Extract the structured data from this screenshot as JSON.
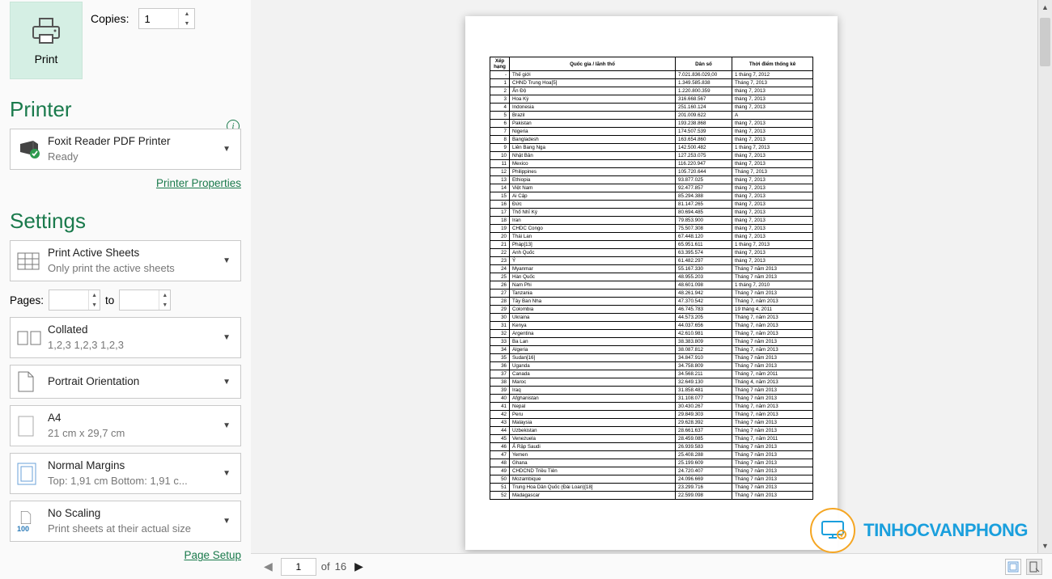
{
  "print": {
    "label": "Print"
  },
  "copies": {
    "label": "Copies:",
    "value": "1"
  },
  "printer_section": {
    "title": "Printer"
  },
  "printer": {
    "name": "Foxit Reader PDF Printer",
    "status": "Ready",
    "properties_link": "Printer Properties"
  },
  "settings_section": {
    "title": "Settings"
  },
  "print_what": {
    "label": "Print Active Sheets",
    "sub": "Only print the active sheets"
  },
  "pages": {
    "label": "Pages:",
    "to": "to",
    "from": "",
    "to_val": ""
  },
  "collate": {
    "label": "Collated",
    "sub": "1,2,3    1,2,3    1,2,3"
  },
  "orientation": {
    "label": "Portrait Orientation"
  },
  "paper": {
    "label": "A4",
    "sub": "21 cm x 29,7 cm"
  },
  "margins": {
    "label": "Normal Margins",
    "sub": "Top: 1,91 cm Bottom: 1,91 c..."
  },
  "scaling": {
    "label": "No Scaling",
    "sub": "Print sheets at their actual size"
  },
  "page_setup_link": "Page Setup",
  "nav": {
    "current_page": "1",
    "page_count": "16",
    "of": "of"
  },
  "watermark": {
    "text": "TINHOCVANPHONG"
  },
  "doc": {
    "headers": [
      "Xếp hạng",
      "Quốc gia / lãnh thổ",
      "Dân số",
      "Thời điểm thống kê"
    ],
    "rows": [
      [
        "-",
        "Thế giới",
        "7.021.836.029,00",
        "1 tháng 7, 2012"
      ],
      [
        "1",
        "CHND Trung Hoa[5]",
        "1.349.585.838",
        "Tháng 7, 2013"
      ],
      [
        "2",
        "Ấn Độ",
        "1.220.800.359",
        "tháng 7, 2013"
      ],
      [
        "3",
        "Hoa Kỳ",
        "316.668.567",
        "tháng 7, 2013"
      ],
      [
        "4",
        "Indonesia",
        "251.160.124",
        "tháng 7, 2013"
      ],
      [
        "5",
        "Brazil",
        "201.009.622",
        "A"
      ],
      [
        "6",
        "Pakistan",
        "193.238.868",
        "tháng 7, 2013"
      ],
      [
        "7",
        "Nigeria",
        "174.507.539",
        "tháng 7, 2013"
      ],
      [
        "8",
        "Bangladesh",
        "163.654.860",
        "tháng 7, 2013"
      ],
      [
        "9",
        "Liên Bang Nga",
        "142.500.482",
        "1 tháng 7, 2013"
      ],
      [
        "10",
        "Nhật Bản",
        "127.253.075",
        "tháng 7, 2013"
      ],
      [
        "11",
        "Mexico",
        "116.220.947",
        "tháng 7, 2013"
      ],
      [
        "12",
        "Philippines",
        "105.720.644",
        "Tháng 7, 2013"
      ],
      [
        "13",
        "Ethiopia",
        "93.877.025",
        "tháng 7, 2013"
      ],
      [
        "14",
        "Việt Nam",
        "92.477.857",
        "tháng 7, 2013"
      ],
      [
        "15",
        "Ai Cập",
        "85.294.388",
        "tháng 7, 2013"
      ],
      [
        "16",
        "Đức",
        "81.147.265",
        "tháng 7, 2013"
      ],
      [
        "17",
        "Thổ Nhĩ Kỳ",
        "80.694.485",
        "tháng 7, 2013"
      ],
      [
        "18",
        "Iran",
        "79.853.900",
        "tháng 7, 2013"
      ],
      [
        "19",
        "CHDC Congo",
        "75.507.308",
        "tháng 7, 2013"
      ],
      [
        "20",
        "Thái Lan",
        "67.448.120",
        "tháng 7, 2013"
      ],
      [
        "21",
        "Pháp[13]",
        "65.951.611",
        "1 tháng 7, 2013"
      ],
      [
        "22",
        "Anh Quốc",
        "63.395.574",
        "tháng 7, 2013"
      ],
      [
        "23",
        "Ý",
        "61.482.297",
        "tháng 7, 2013"
      ],
      [
        "24",
        "Myanmar",
        "55.167.330",
        "Tháng 7 năm 2013"
      ],
      [
        "25",
        "Hàn Quốc",
        "48.955.203",
        "Tháng 7 năm 2013"
      ],
      [
        "26",
        "Nam Phi",
        "48.601.098",
        "1 tháng 7, 2010"
      ],
      [
        "27",
        "Tanzania",
        "48.261.942",
        "Tháng 7 năm 2013"
      ],
      [
        "28",
        "Tây Ban Nha",
        "47.370.542",
        "Tháng 7, năm 2013"
      ],
      [
        "29",
        "Colombia",
        "46.745.783",
        "19 tháng 4, 2011"
      ],
      [
        "30",
        "Ukraina",
        "44.573.205",
        "Tháng 7, năm 2013"
      ],
      [
        "31",
        "Kenya",
        "44.037.656",
        "Tháng 7, năm 2013"
      ],
      [
        "32",
        "Argentina",
        "42.610.981",
        "Tháng 7, năm 2013"
      ],
      [
        "33",
        "Ba Lan",
        "38.383.809",
        "Tháng 7 năm 2013"
      ],
      [
        "34",
        "Algeria",
        "38.087.812",
        "Tháng 7, năm 2013"
      ],
      [
        "35",
        "Sudan[16]",
        "34.847.910",
        "Tháng 7 năm 2013"
      ],
      [
        "36",
        "Uganda",
        "34.758.809",
        "Tháng 7 năm 2013"
      ],
      [
        "37",
        "Canada",
        "34.568.211",
        "Tháng 7, năm 2011"
      ],
      [
        "38",
        "Maroc",
        "32.649.130",
        "Tháng 4, năm 2013"
      ],
      [
        "39",
        "Iraq",
        "31.858.481",
        "Tháng 7 năm 2013"
      ],
      [
        "40",
        "Afghanistan",
        "31.108.077",
        "Tháng 7 năm 2013"
      ],
      [
        "41",
        "Nepal",
        "30.430.267",
        "Tháng 7, năm 2013"
      ],
      [
        "42",
        "Peru",
        "29.849.303",
        "Tháng 7, năm 2013"
      ],
      [
        "43",
        "Malaysia",
        "29.628.392",
        "Tháng 7 năm 2013"
      ],
      [
        "44",
        "Uzbekistan",
        "28.661.637",
        "Tháng 7 năm 2013"
      ],
      [
        "45",
        "Venezuela",
        "28.459.085",
        "Tháng 7, năm 2011"
      ],
      [
        "46",
        "Ả Rập Saudi",
        "26.939.583",
        "Tháng 7 năm 2013"
      ],
      [
        "47",
        "Yemen",
        "25.408.288",
        "Tháng 7 năm 2013"
      ],
      [
        "48",
        "Ghana",
        "25.199.609",
        "Tháng 7 năm 2013"
      ],
      [
        "49",
        "CHDCND Triều Tiên",
        "24.720.407",
        "Tháng 7 năm 2013"
      ],
      [
        "50",
        "Mozambique",
        "24.096.669",
        "Tháng 7 năm 2013"
      ],
      [
        "51",
        "Trung Hoa Dân Quốc (Đài Loan)[18]",
        "23.299.716",
        "Tháng 7 năm 2013"
      ],
      [
        "52",
        "Madagascar",
        "22.599.098",
        "Tháng 7 năm 2013"
      ]
    ]
  },
  "scaling_icon_100": "100"
}
